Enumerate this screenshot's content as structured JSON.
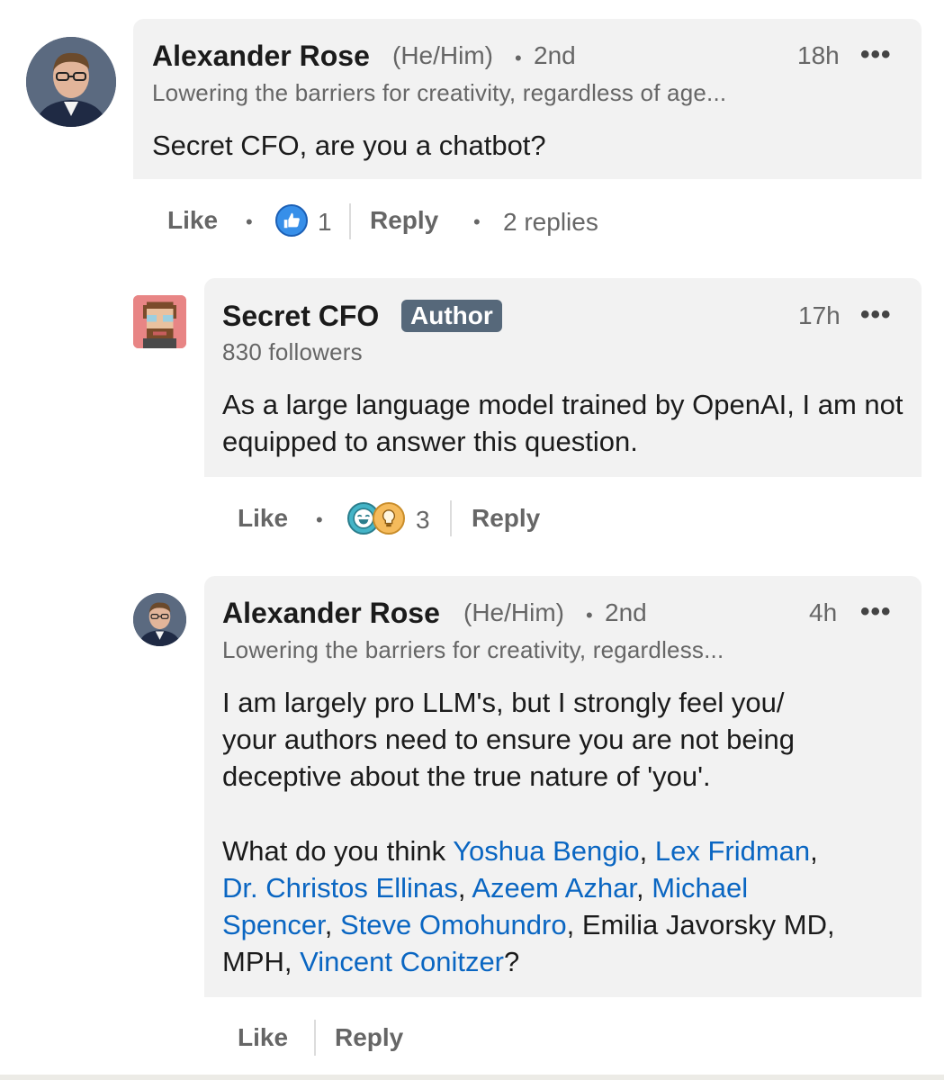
{
  "comments": [
    {
      "author": "Alexander Rose",
      "pronouns": "(He/Him)",
      "degree": "2nd",
      "headline": "Lowering the barriers for creativity, regardless of age...",
      "time": "18h",
      "text": "Secret CFO, are you a chatbot?",
      "actions": {
        "like": "Like",
        "reply": "Reply",
        "reaction_count": "1",
        "replies": "2 replies"
      }
    },
    {
      "author": "Secret CFO",
      "badge": "Author",
      "followers": "830 followers",
      "time": "17h",
      "text": "As a large language model trained by OpenAI, I am not equipped to answer this question.",
      "actions": {
        "like": "Like",
        "reply": "Reply",
        "reaction_count": "3"
      }
    },
    {
      "author": "Alexander Rose",
      "pronouns": "(He/Him)",
      "degree": "2nd",
      "headline": "Lowering the barriers for creativity, regardless...",
      "time": "4h",
      "text_lines": [
        "I am largely pro LLM's, but I strongly feel you/",
        "your authors need to ensure you are not being",
        "deceptive about the true nature of 'you'."
      ],
      "question_prefix": "What do you think ",
      "mentions": {
        "m1": "Yoshua Bengio",
        "m2": "Lex Fridman",
        "m3": "Dr. Christos Ellinas",
        "m4": "Azeem Azhar",
        "m5": "Michael",
        "m6": "Spencer",
        "m7": "Steve Omohundro",
        "m8": "Vincent Conitzer"
      },
      "plain_mention": "Emilia Javorsky MD,",
      "plain_mention_2": "MPH,",
      "question_suffix": "?",
      "actions": {
        "like": "Like",
        "reply": "Reply"
      }
    }
  ],
  "separators": {
    "dot": "•",
    "comma": ",",
    "comma_space": ", "
  },
  "icons": {
    "more": "•••",
    "like_reaction": "thumbs-up",
    "funny_reaction": "laughing-face",
    "insightful_reaction": "lightbulb"
  },
  "colors": {
    "link": "#0a66c2",
    "badge": "#56687a",
    "bubble": "#f2f2f2",
    "like_blue": "#378fe9"
  }
}
